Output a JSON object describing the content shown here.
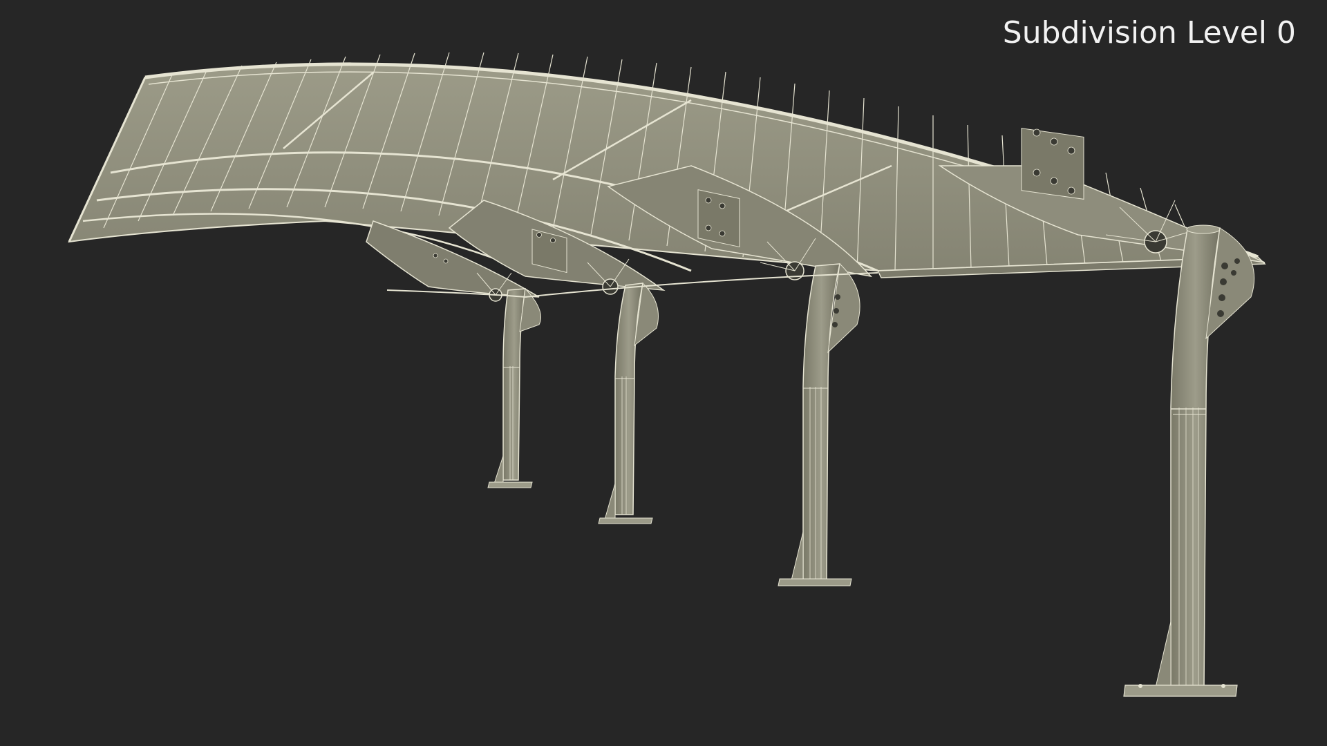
{
  "overlay": {
    "label": "Subdivision Level 0"
  },
  "scene": {
    "subject": "carport-canopy-wireframe",
    "colors": {
      "background": "#262626",
      "surface": "#8c8b7a",
      "surface_light": "#a09f8d",
      "surface_dark": "#6e6d60",
      "wire": "#e6e4d2",
      "hole": "#3a3a33",
      "label": "#f2f2f2"
    }
  }
}
